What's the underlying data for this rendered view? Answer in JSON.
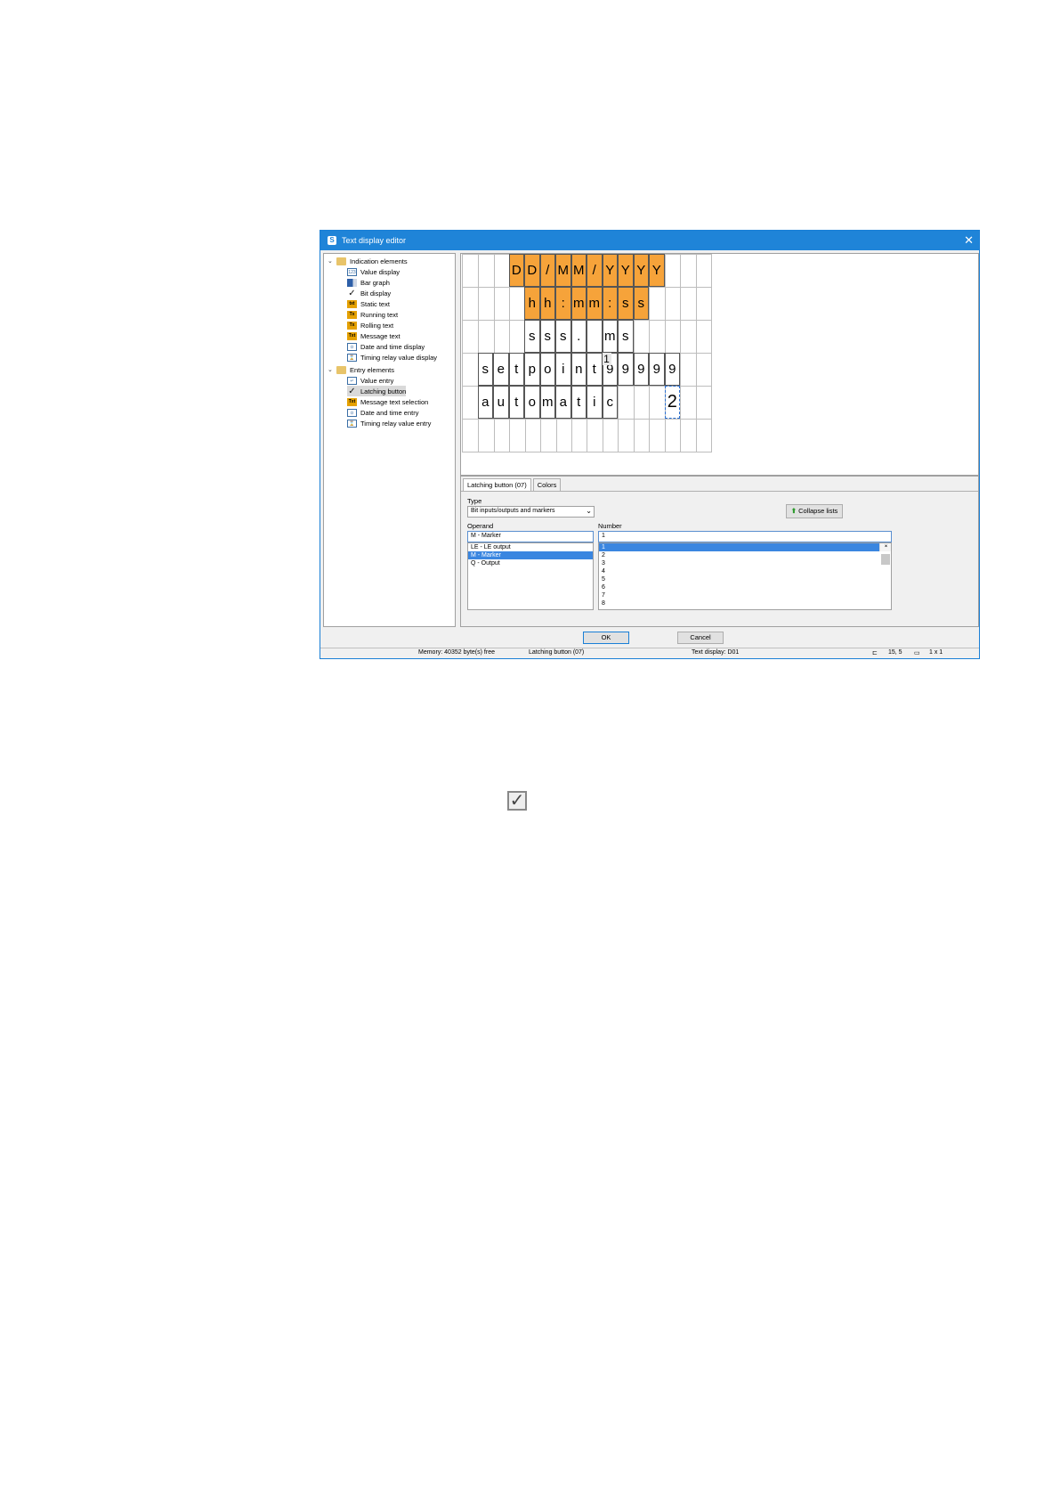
{
  "window": {
    "title": "Text display editor",
    "close_glyph": "✕"
  },
  "tree": {
    "groups": [
      {
        "label": "Indication elements",
        "items": [
          "Value display",
          "Bar graph",
          "Bit display",
          "Static text",
          "Running text",
          "Rolling text",
          "Message text",
          "Date and time display",
          "Timing relay value display"
        ]
      },
      {
        "label": "Entry elements",
        "items": [
          "Value entry",
          "Latching button",
          "Message text selection",
          "Date and time entry",
          "Timing relay value entry"
        ]
      }
    ],
    "selected": "Latching button"
  },
  "display": {
    "row1": [
      "D",
      "D",
      "/",
      "M",
      "M",
      "/",
      "Y",
      "Y",
      "Y",
      "Y"
    ],
    "row2": [
      "h",
      "h",
      ":",
      "m",
      "m",
      ":",
      "s",
      "s"
    ],
    "row3": [
      "s",
      "s",
      "s",
      ".",
      "",
      "m",
      "s"
    ],
    "row4": [
      "s",
      "e",
      "t",
      "p",
      "o",
      "i",
      "n",
      "t"
    ],
    "row4_value": [
      "9",
      "9",
      "9",
      "9",
      "9"
    ],
    "row4_marker": "1",
    "row5": [
      "a",
      "u",
      "t",
      "o",
      "m",
      "a",
      "t",
      "i",
      "c"
    ],
    "row5_marker": "2"
  },
  "properties": {
    "tabs": [
      "Latching button (07)",
      "Colors"
    ],
    "type_label": "Type",
    "type_value": "Bit inputs/outputs and markers",
    "collapse_button": "Collapse lists",
    "operand_label": "Operand",
    "operand_value": "M - Marker",
    "operand_options": [
      "LE - LE output",
      "M - Marker",
      "Q - Output"
    ],
    "operand_selected": 1,
    "number_label": "Number",
    "number_value": "1",
    "number_options": [
      "1",
      "2",
      "3",
      "4",
      "5",
      "6",
      "7",
      "8"
    ],
    "number_selected": 0
  },
  "buttons": {
    "ok": "OK",
    "cancel": "Cancel"
  },
  "statusbar": {
    "memory": "Memory: 40352 byte(s) free",
    "element": "Latching button (07)",
    "display": "Text display: D01",
    "position": "15, 5",
    "size": "1 x 1"
  },
  "icons": [
    "app-icon",
    "folder-icon",
    "checkbox-icon"
  ]
}
